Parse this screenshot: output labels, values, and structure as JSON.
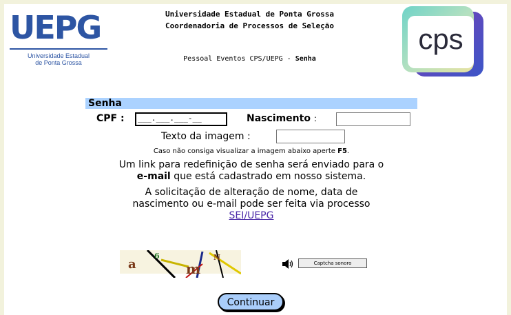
{
  "header": {
    "university_logo_text": "UEPG",
    "university_logo_sub": [
      "Universidade Estadual",
      "de Ponta Grossa"
    ],
    "title_line1": "Universidade Estadual de Ponta Grossa",
    "title_line2": "Coordenadoria de Processos de Seleção",
    "subtitle_prefix": "Pessoal Eventos CPS/UEPG - ",
    "subtitle_bold": "Senha",
    "cps_logo_text": "cps"
  },
  "form": {
    "heading": "Senha",
    "cpf_label": "CPF",
    "cpf_colon": ":",
    "cpf_value": "___.___.___-__",
    "birth_label": "Nascimento",
    "birth_colon": ":",
    "birth_value": "",
    "image_text_label": "Texto da imagem :",
    "image_text_value": "",
    "hint_prefix": "Caso não consiga visualizar a imagem abaixo aperte ",
    "hint_key": "F5",
    "hint_suffix": ".",
    "reset_line1": "Um link para redefinição de senha será enviado para o",
    "reset_bold": "e-mail",
    "reset_line2_rest": " que está cadastrado em nosso sistema.",
    "change_line1": "A solicitação de alteração de nome, data de",
    "change_line2": "nascimento ou e-mail pode ser feita via processo",
    "sei_link": "SEI/UEPG"
  },
  "captcha": {
    "chars": [
      "a",
      "6",
      "m",
      "N"
    ],
    "audio_button_label": "Captcha sonoro",
    "speaker_icon": "speaker-icon"
  },
  "actions": {
    "continue_label": "Continuar"
  },
  "colors": {
    "page_bg": "#f2f2dc",
    "heading_bar": "#abd2ff",
    "uepg_blue": "#2d55a3",
    "button_blue": "#a9cdfa",
    "link": "#4b2aa8"
  }
}
